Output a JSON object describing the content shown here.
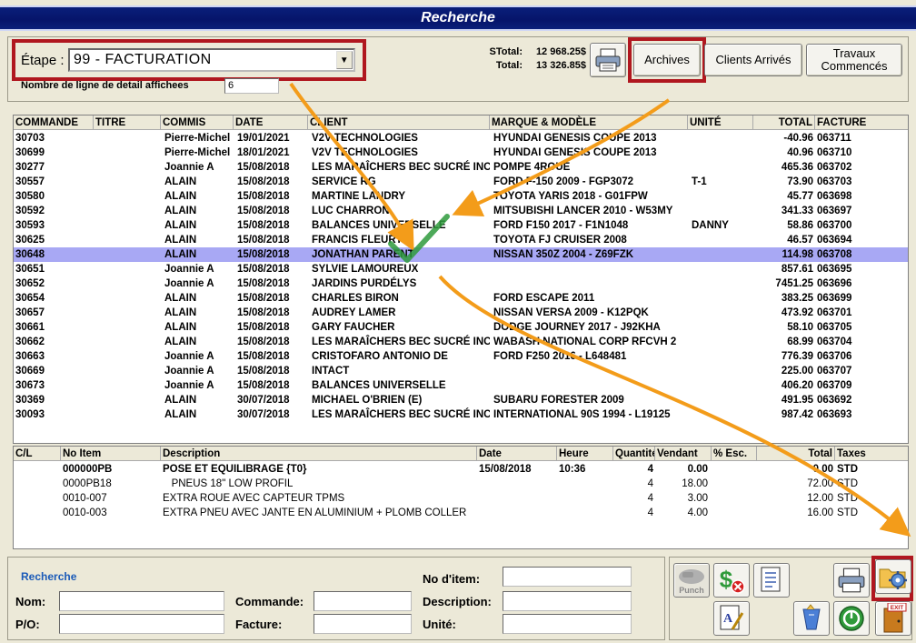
{
  "window": {
    "title": "Recherche"
  },
  "toolbar": {
    "etape_label": "Étape :",
    "etape_value": "99 - FACTURATION",
    "nb_lignes_label": "Nombre de ligne de detail affichees",
    "nb_lignes_value": "6",
    "stotal_label": "STotal:",
    "stotal_value": "12 968.25$",
    "total_label": "Total:",
    "total_value": "13 326.85$",
    "print_icon": "printer-icon",
    "archives_label": "Archives",
    "clients_label": "Clients Arrivés",
    "travaux_label_1": "Travaux",
    "travaux_label_2": "Commencés"
  },
  "orders": {
    "columns": [
      "COMMANDE",
      "TITRE",
      "COMMIS",
      "DATE",
      "CLIENT",
      "MARQUE & MODÈLE",
      "UNITÉ",
      "TOTAL",
      "FACTURE"
    ],
    "rows": [
      {
        "commande": "30703",
        "titre": "",
        "commis": "Pierre-Michel",
        "date": "19/01/2021",
        "client": "V2V TECHNOLOGIES",
        "marque": "HYUNDAI GENESIS COUPE 2013",
        "unite": "",
        "total": "-40.96",
        "facture": "063711"
      },
      {
        "commande": "30699",
        "titre": "",
        "commis": "Pierre-Michel",
        "date": "18/01/2021",
        "client": "V2V TECHNOLOGIES",
        "marque": "HYUNDAI GENESIS COUPE 2013",
        "unite": "",
        "total": "40.96",
        "facture": "063710"
      },
      {
        "commande": "30277",
        "titre": "",
        "commis": "Joannie A",
        "date": "15/08/2018",
        "client": "LES MARAÎCHERS BEC SUCRÉ INC",
        "marque": "POMPE 4ROUE",
        "unite": "",
        "total": "465.36",
        "facture": "063702"
      },
      {
        "commande": "30557",
        "titre": "",
        "commis": "ALAIN",
        "date": "15/08/2018",
        "client": "SERVICE RG",
        "marque": "FORD F-150 2009 - FGP3072",
        "unite": "T-1",
        "total": "73.90",
        "facture": "063703"
      },
      {
        "commande": "30580",
        "titre": "",
        "commis": "ALAIN",
        "date": "15/08/2018",
        "client": "MARTINE LANDRY",
        "marque": "TOYOTA YARIS 2018 - G01FPW",
        "unite": "",
        "total": "45.77",
        "facture": "063698"
      },
      {
        "commande": "30592",
        "titre": "",
        "commis": "ALAIN",
        "date": "15/08/2018",
        "client": "LUC CHARRON",
        "marque": "MITSUBISHI LANCER 2010 - W53MY",
        "unite": "",
        "total": "341.33",
        "facture": "063697"
      },
      {
        "commande": "30593",
        "titre": "",
        "commis": "ALAIN",
        "date": "15/08/2018",
        "client": "BALANCES UNIVERSELLE",
        "marque": "FORD F150 2017 - F1N1048",
        "unite": "DANNY",
        "total": "58.86",
        "facture": "063700"
      },
      {
        "commande": "30625",
        "titre": "",
        "commis": "ALAIN",
        "date": "15/08/2018",
        "client": "FRANCIS FLEURY",
        "marque": "TOYOTA FJ CRUISER 2008",
        "unite": "",
        "total": "46.57",
        "facture": "063694"
      },
      {
        "commande": "30648",
        "titre": "",
        "commis": "ALAIN",
        "date": "15/08/2018",
        "client": "JONATHAN PARENT",
        "marque": "NISSAN 350Z 2004 - Z69FZK",
        "unite": "",
        "total": "114.98",
        "facture": "063708",
        "selected": true
      },
      {
        "commande": "30651",
        "titre": "",
        "commis": "Joannie A",
        "date": "15/08/2018",
        "client": "SYLVIE LAMOUREUX",
        "marque": "",
        "unite": "",
        "total": "857.61",
        "facture": "063695"
      },
      {
        "commande": "30652",
        "titre": "",
        "commis": "Joannie A",
        "date": "15/08/2018",
        "client": "JARDINS PURDÉLYS",
        "marque": "",
        "unite": "",
        "total": "7451.25",
        "facture": "063696"
      },
      {
        "commande": "30654",
        "titre": "",
        "commis": "ALAIN",
        "date": "15/08/2018",
        "client": "CHARLES BIRON",
        "marque": "FORD ESCAPE 2011",
        "unite": "",
        "total": "383.25",
        "facture": "063699"
      },
      {
        "commande": "30657",
        "titre": "",
        "commis": "ALAIN",
        "date": "15/08/2018",
        "client": "AUDREY LAMER",
        "marque": "NISSAN VERSA 2009 - K12PQK",
        "unite": "",
        "total": "473.92",
        "facture": "063701"
      },
      {
        "commande": "30661",
        "titre": "",
        "commis": "ALAIN",
        "date": "15/08/2018",
        "client": "GARY FAUCHER",
        "marque": "DODGE JOURNEY 2017 - J92KHA",
        "unite": "",
        "total": "58.10",
        "facture": "063705"
      },
      {
        "commande": "30662",
        "titre": "",
        "commis": "ALAIN",
        "date": "15/08/2018",
        "client": "LES MARAÎCHERS BEC SUCRÉ INC",
        "marque": "WABASH NATIONAL CORP RFCVH 2",
        "unite": "",
        "total": "68.99",
        "facture": "063704"
      },
      {
        "commande": "30663",
        "titre": "",
        "commis": "Joannie A",
        "date": "15/08/2018",
        "client": "CRISTOFARO ANTONIO DE",
        "marque": "FORD F250 2016 - L648481",
        "unite": "",
        "total": "776.39",
        "facture": "063706"
      },
      {
        "commande": "30669",
        "titre": "",
        "commis": "Joannie A",
        "date": "15/08/2018",
        "client": "INTACT",
        "marque": "",
        "unite": "",
        "total": "225.00",
        "facture": "063707"
      },
      {
        "commande": "30673",
        "titre": "",
        "commis": "Joannie A",
        "date": "15/08/2018",
        "client": "BALANCES UNIVERSELLE",
        "marque": "",
        "unite": "",
        "total": "406.20",
        "facture": "063709"
      },
      {
        "commande": "30369",
        "titre": "",
        "commis": "ALAIN",
        "date": "30/07/2018",
        "client": "MICHAEL O'BRIEN (E)",
        "marque": "SUBARU FORESTER 2009",
        "unite": "",
        "total": "491.95",
        "facture": "063692"
      },
      {
        "commande": "30093",
        "titre": "",
        "commis": "ALAIN",
        "date": "30/07/2018",
        "client": "LES MARAÎCHERS BEC SUCRÉ INC",
        "marque": "INTERNATIONAL 90S 1994 - L19125",
        "unite": "",
        "total": "987.42",
        "facture": "063693"
      }
    ]
  },
  "details": {
    "columns": [
      "C/L",
      "No Item",
      "Description",
      "Date",
      "Heure",
      "Quantité",
      "Vendant",
      "% Esc.",
      "Total",
      "Taxes"
    ],
    "rows": [
      {
        "cl": "",
        "item": "000000PB",
        "desc": "POSE ET EQUILIBRAGE {T0}",
        "date": "15/08/2018",
        "heure": "10:36",
        "qte": "4",
        "vendant": "0.00",
        "esc": "",
        "total": "0.00",
        "taxes": "STD",
        "bold": true
      },
      {
        "cl": "",
        "item": "0000PB18",
        "desc": "   PNEUS 18\" LOW PROFIL",
        "date": "",
        "heure": "",
        "qte": "4",
        "vendant": "18.00",
        "esc": "",
        "total": "72.00",
        "taxes": "STD"
      },
      {
        "cl": "",
        "item": "0010-007",
        "desc": "EXTRA ROUE AVEC CAPTEUR TPMS",
        "date": "",
        "heure": "",
        "qte": "4",
        "vendant": "3.00",
        "esc": "",
        "total": "12.00",
        "taxes": "STD"
      },
      {
        "cl": "",
        "item": "0010-003",
        "desc": "EXTRA PNEU AVEC JANTE EN ALUMINIUM + PLOMB COLLER",
        "date": "",
        "heure": "",
        "qte": "4",
        "vendant": "4.00",
        "esc": "",
        "total": "16.00",
        "taxes": "STD"
      }
    ]
  },
  "search": {
    "title": "Recherche",
    "nom_label": "Nom:",
    "po_label": "P/O:",
    "commande_label": "Commande:",
    "facture_label": "Facture:",
    "noitem_label": "No d'item:",
    "description_label": "Description:",
    "unite_label": "Unité:"
  },
  "buttons": {
    "punch_label": "Punch",
    "exit_label": "EXIT",
    "icons": [
      "punch-icon",
      "money-remove-icon",
      "document-list-icon",
      "printer-icon",
      "settings-folder-icon",
      "edit-document-icon",
      "broom-icon",
      "confirm-icon",
      "exit-door-icon"
    ]
  },
  "colors": {
    "title_bar": "#06146a",
    "selected_row": "#a8a8f4",
    "highlight_box": "#b0171f",
    "annotation_arrow": "#f39c1a"
  }
}
